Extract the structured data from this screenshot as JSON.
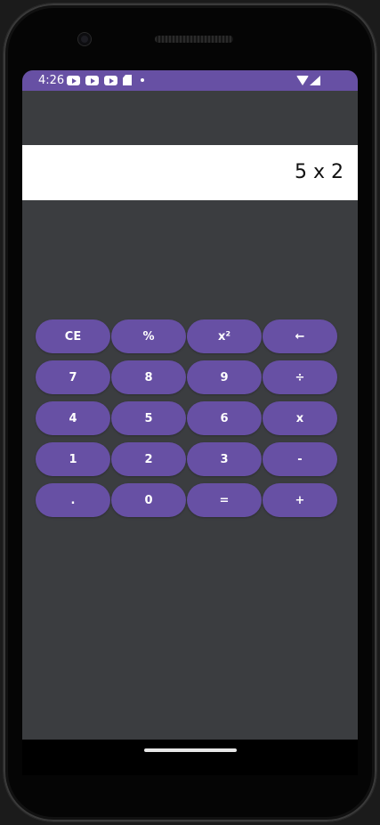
{
  "status_bar": {
    "time": "4:26",
    "notification_icons": [
      "youtube-icon",
      "youtube-icon",
      "youtube-icon",
      "sd-card-icon",
      "dot-icon"
    ],
    "system_icons": [
      "wifi-icon",
      "signal-icon"
    ]
  },
  "display": {
    "expression": "5 x 2"
  },
  "keypad": {
    "keys": [
      [
        "CE",
        "%",
        "x²",
        "←"
      ],
      [
        "7",
        "8",
        "9",
        "÷"
      ],
      [
        "4",
        "5",
        "6",
        "x"
      ],
      [
        "1",
        "2",
        "3",
        "-"
      ],
      [
        ".",
        "0",
        "=",
        "+"
      ]
    ]
  },
  "colors": {
    "accent": "#6750a4",
    "background": "#3b3d40",
    "display_background": "#ffffff"
  }
}
